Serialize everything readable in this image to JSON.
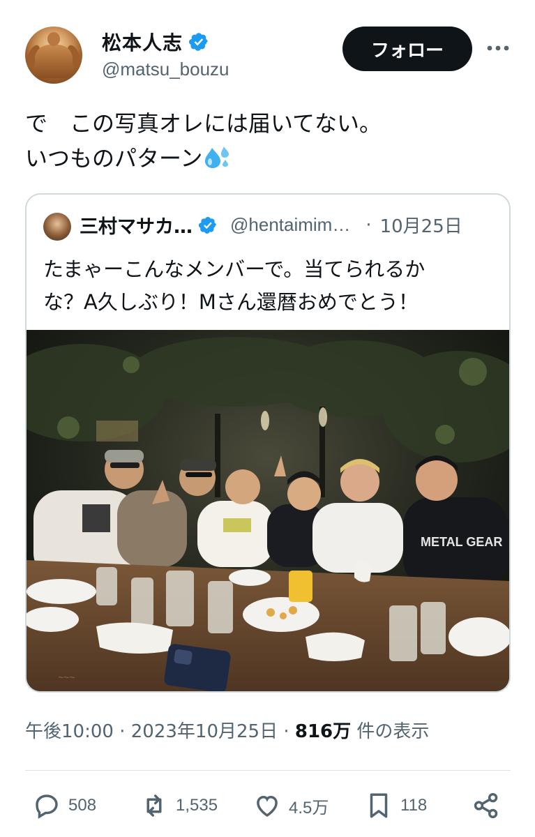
{
  "user": {
    "display_name": "松本人志",
    "handle": "@matsu_bouzu",
    "verified": true,
    "avatar_icon": "bodybuilder-avatar"
  },
  "follow_label": "フォロー",
  "more_icon": "more-dots-icon",
  "tweet": {
    "lines": [
      "で　この写真オレには届いてない。",
      "いつものパターン"
    ],
    "emoji": "sweat-droplets-icon"
  },
  "quote": {
    "display_name": "三村マサカ…",
    "handle": "@hentaimim…",
    "separator": "·",
    "date": "10月25日",
    "verified": true,
    "lines": [
      "たまゃーこんなメンバーで。当てられるか",
      "な？A久しぶり！Mさん還暦おめでとう！"
    ],
    "photo_icon": "group-dinner-photo"
  },
  "meta": {
    "time": "午後10:00",
    "sep1": " · ",
    "date": "2023年10月25日",
    "sep2": " · ",
    "views": "816万",
    "views_suffix": " 件の表示"
  },
  "actions": {
    "reply": {
      "icon": "reply-icon",
      "count": "508"
    },
    "retweet": {
      "icon": "retweet-icon",
      "count": "1,535"
    },
    "like": {
      "icon": "heart-icon",
      "count": "4.5万"
    },
    "bookmark": {
      "icon": "bookmark-icon",
      "count": "118"
    },
    "share": {
      "icon": "share-icon"
    }
  },
  "colors": {
    "verified_blue": "#1d9bf0",
    "muted_text": "#536471",
    "primary_text": "#0f1419"
  }
}
